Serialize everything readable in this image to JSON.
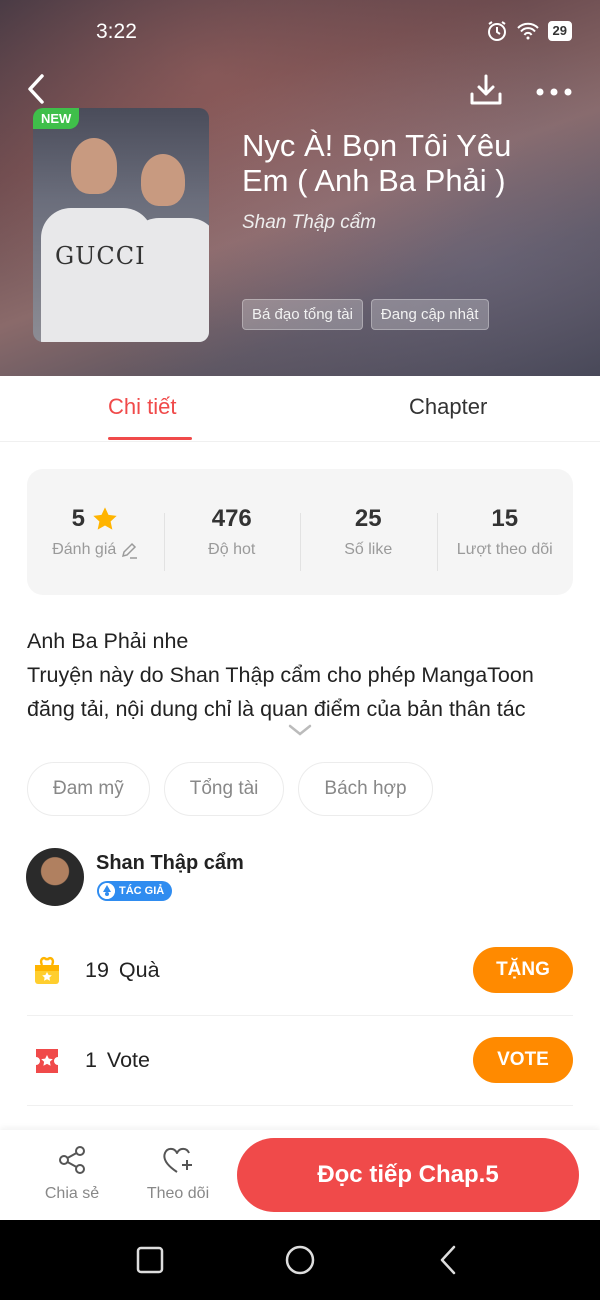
{
  "status_bar": {
    "time": "3:22",
    "battery": "29"
  },
  "story": {
    "title": "Nyc À! Bọn Tôi Yêu Em ( Anh Ba Phải )",
    "author": "Shan Thập cẩm",
    "new_badge": "NEW",
    "cover_text": "GUCCI",
    "tags": [
      "Bá đạo tổng tài",
      "Đang cập nhật"
    ]
  },
  "tabs": {
    "detail": "Chi tiết",
    "chapter": "Chapter"
  },
  "stats": [
    {
      "value": "5",
      "label": "Đánh giá"
    },
    {
      "value": "476",
      "label": "Độ hot"
    },
    {
      "value": "25",
      "label": "Số like"
    },
    {
      "value": "15",
      "label": "Lượt theo dõi"
    }
  ],
  "description": "Anh Ba Phải nhe\nTruyện này do Shan Thập cẩm cho phép MangaToon đăng tải, nội dung chỉ là quan điểm của bản thân tác",
  "genres": [
    "Đam mỹ",
    "Tổng tài",
    "Bách hợp"
  ],
  "author_row": {
    "name": "Shan Thập cẩm",
    "badge": "TÁC GIẢ"
  },
  "gift": {
    "text": "19 Quà",
    "button": "TẶNG"
  },
  "vote": {
    "text": "1 Vote",
    "button": "VOTE"
  },
  "bottom_bar": {
    "share": "Chia sẻ",
    "follow": "Theo dõi",
    "read": "Đọc tiếp Chap.5"
  },
  "colors": {
    "accent": "#f04a4a",
    "orange": "#ff8a00",
    "new_badge": "#3fbf4a",
    "author_badge": "#2f8cf0"
  }
}
